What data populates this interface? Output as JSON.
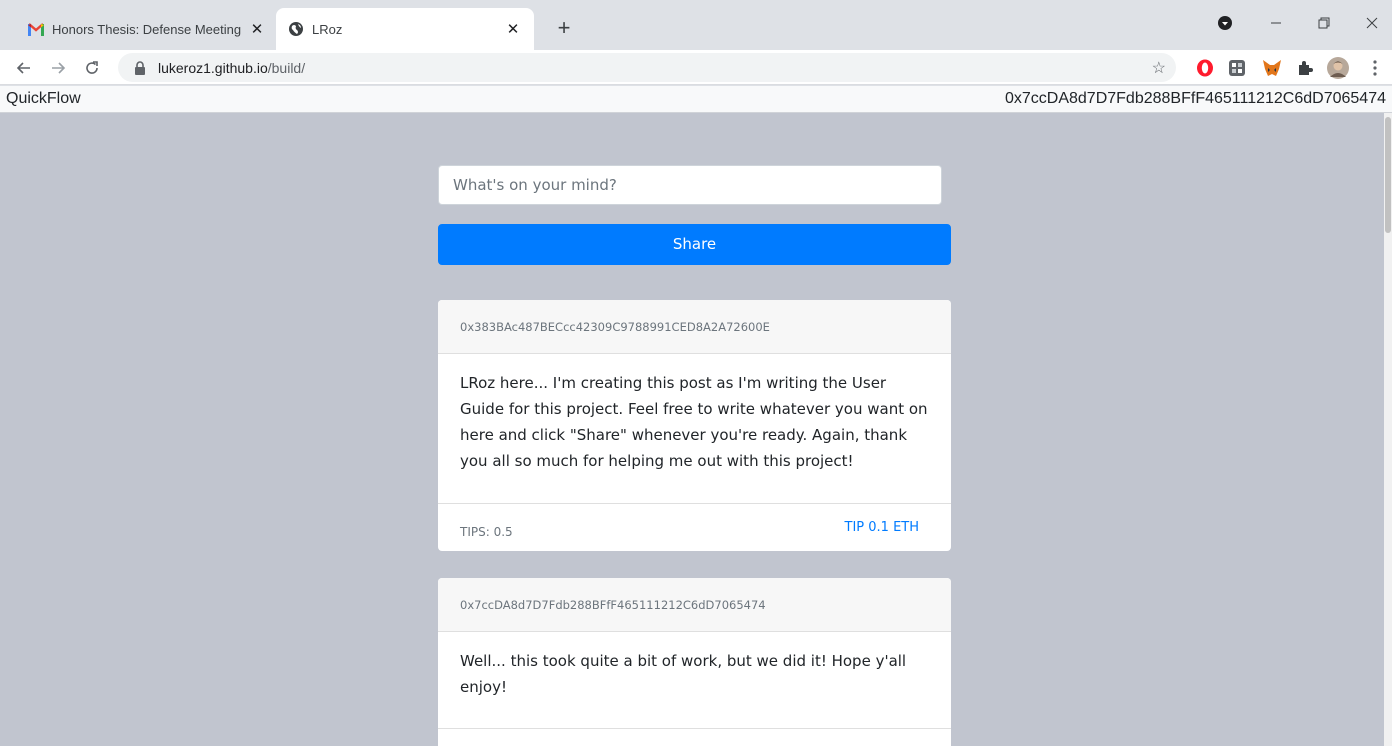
{
  "browser": {
    "tabs": [
      {
        "title": "Honors Thesis: Defense Meeting",
        "active": false,
        "icon": "gmail-icon"
      },
      {
        "title": "LRoz",
        "active": true,
        "icon": "globe-icon"
      }
    ],
    "url_host": "lukeroz1.github.io",
    "url_path": "/build/"
  },
  "app": {
    "brand": "QuickFlow",
    "account": "0x7ccDA8d7D7Fdb288BFfF465111212C6dD7065474"
  },
  "composer": {
    "placeholder": "What's on your mind?",
    "share_label": "Share"
  },
  "posts": [
    {
      "author": "0x383BAc487BECcc42309C9788991CED8A2A72600E",
      "content": "LRoz here... I'm creating this post as I'm writing the User Guide for this project. Feel free to write whatever you want on here and click \"Share\" whenever you're ready. Again, thank you all so much for helping me out with this project!",
      "tips": "TIPS: 0.5",
      "tip_label": "TIP 0.1 ETH"
    },
    {
      "author": "0x7ccDA8d7D7Fdb288BFfF465111212C6dD7065474",
      "content": "Well... this took quite a bit of work, but we did it! Hope y'all enjoy!"
    }
  ],
  "colors": {
    "primary": "#007bff",
    "page_background": "#c1c5cf"
  }
}
